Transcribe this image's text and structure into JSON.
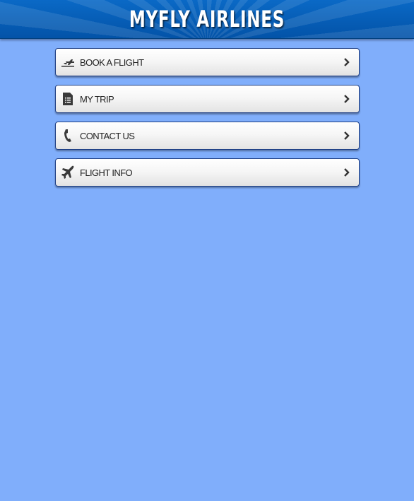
{
  "header": {
    "title": "MYFLY AIRLINES"
  },
  "menu": {
    "items": [
      {
        "label": "BOOK A FLIGHT",
        "icon": "plane-takeoff-icon"
      },
      {
        "label": "MY TRIP",
        "icon": "document-list-icon"
      },
      {
        "label": "CONTACT US",
        "icon": "phone-icon"
      },
      {
        "label": "FLIGHT INFO",
        "icon": "plane-icon"
      }
    ]
  },
  "colors": {
    "background": "#80aefb",
    "header": "#0a69c6",
    "button_border": "#1e3f85"
  }
}
